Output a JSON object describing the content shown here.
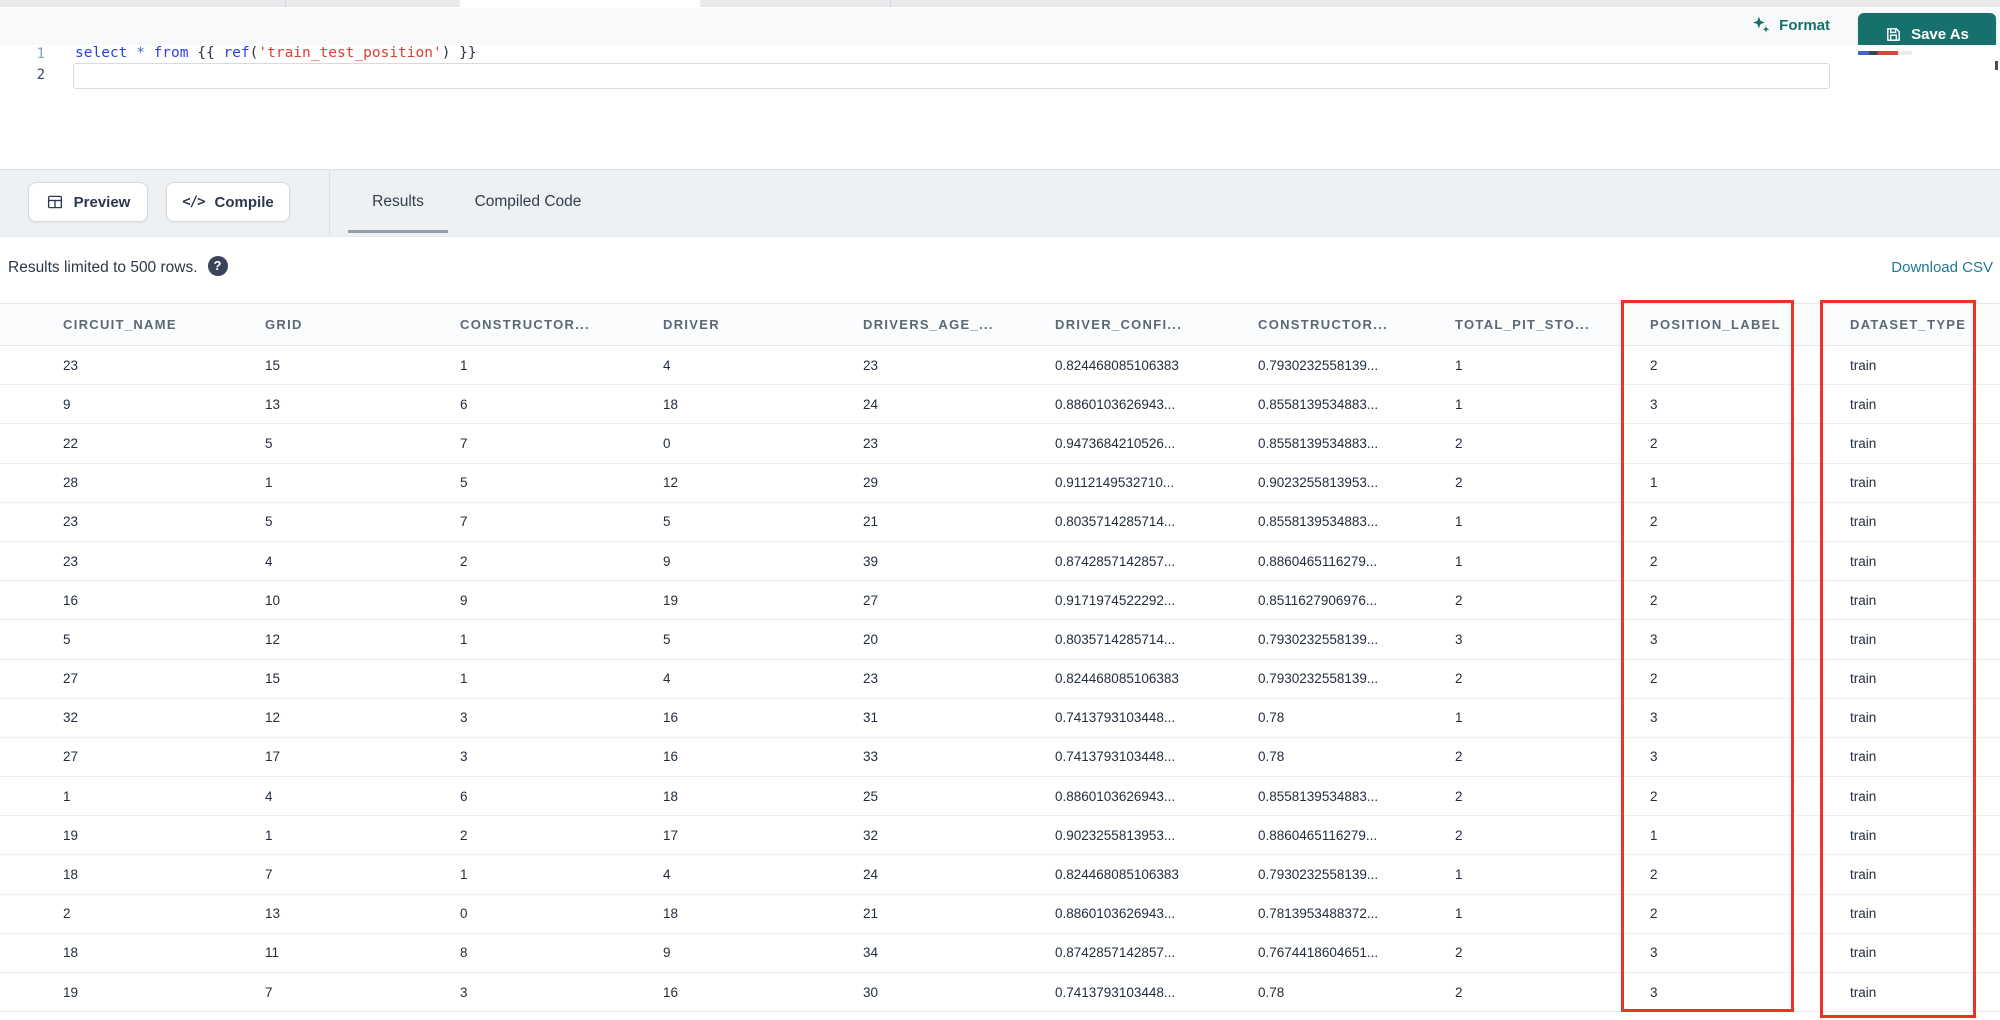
{
  "toolbar": {
    "format_label": "Format",
    "save_as_label": "Save As"
  },
  "editor": {
    "lines": [
      {
        "number": "1",
        "tokens": [
          {
            "t": "select ",
            "c": "kw"
          },
          {
            "t": "* ",
            "c": "op"
          },
          {
            "t": "from ",
            "c": "kw"
          },
          {
            "t": "{{ ",
            "c": "br"
          },
          {
            "t": "ref",
            "c": "fn"
          },
          {
            "t": "(",
            "c": "br"
          },
          {
            "t": "'train_test_position'",
            "c": "str"
          },
          {
            "t": ")",
            "c": "br"
          },
          {
            "t": " }}",
            "c": "br"
          }
        ]
      },
      {
        "number": "2",
        "tokens": []
      }
    ]
  },
  "actions": {
    "preview_label": "Preview",
    "compile_label": "Compile"
  },
  "tabs": [
    {
      "label": "Results",
      "active": true
    },
    {
      "label": "Compiled Code",
      "active": false
    }
  ],
  "results_bar": {
    "message": "Results limited to 500 rows.",
    "help_icon": "question-mark",
    "download_label": "Download CSV"
  },
  "table": {
    "columns": [
      "CIRCUIT_NAME",
      "GRID",
      "CONSTRUCTOR...",
      "DRIVER",
      "DRIVERS_AGE_...",
      "DRIVER_CONFI...",
      "CONSTRUCTOR...",
      "TOTAL_PIT_STO...",
      "POSITION_LABEL",
      "DATASET_TYPE"
    ],
    "rows": [
      [
        "23",
        "15",
        "1",
        "4",
        "23",
        "0.824468085106383",
        "0.7930232558139...",
        "1",
        "2",
        "train"
      ],
      [
        "9",
        "13",
        "6",
        "18",
        "24",
        "0.8860103626943...",
        "0.8558139534883...",
        "1",
        "3",
        "train"
      ],
      [
        "22",
        "5",
        "7",
        "0",
        "23",
        "0.9473684210526...",
        "0.8558139534883...",
        "2",
        "2",
        "train"
      ],
      [
        "28",
        "1",
        "5",
        "12",
        "29",
        "0.9112149532710...",
        "0.9023255813953...",
        "2",
        "1",
        "train"
      ],
      [
        "23",
        "5",
        "7",
        "5",
        "21",
        "0.8035714285714...",
        "0.8558139534883...",
        "1",
        "2",
        "train"
      ],
      [
        "23",
        "4",
        "2",
        "9",
        "39",
        "0.8742857142857...",
        "0.8860465116279...",
        "1",
        "2",
        "train"
      ],
      [
        "16",
        "10",
        "9",
        "19",
        "27",
        "0.9171974522292...",
        "0.8511627906976...",
        "2",
        "2",
        "train"
      ],
      [
        "5",
        "12",
        "1",
        "5",
        "20",
        "0.8035714285714...",
        "0.7930232558139...",
        "3",
        "3",
        "train"
      ],
      [
        "27",
        "15",
        "1",
        "4",
        "23",
        "0.824468085106383",
        "0.7930232558139...",
        "2",
        "2",
        "train"
      ],
      [
        "32",
        "12",
        "3",
        "16",
        "31",
        "0.7413793103448...",
        "0.78",
        "1",
        "3",
        "train"
      ],
      [
        "27",
        "17",
        "3",
        "16",
        "33",
        "0.7413793103448...",
        "0.78",
        "2",
        "3",
        "train"
      ],
      [
        "1",
        "4",
        "6",
        "18",
        "25",
        "0.8860103626943...",
        "0.8558139534883...",
        "2",
        "2",
        "train"
      ],
      [
        "19",
        "1",
        "2",
        "17",
        "32",
        "0.9023255813953...",
        "0.8860465116279...",
        "2",
        "1",
        "train"
      ],
      [
        "18",
        "7",
        "1",
        "4",
        "24",
        "0.824468085106383",
        "0.7930232558139...",
        "1",
        "2",
        "train"
      ],
      [
        "2",
        "13",
        "0",
        "18",
        "21",
        "0.8860103626943...",
        "0.7813953488372...",
        "1",
        "2",
        "train"
      ],
      [
        "18",
        "11",
        "8",
        "9",
        "34",
        "0.8742857142857...",
        "0.7674418604651...",
        "2",
        "3",
        "train"
      ],
      [
        "19",
        "7",
        "3",
        "16",
        "30",
        "0.7413793103448...",
        "0.78",
        "2",
        "3",
        "train"
      ]
    ]
  },
  "annotations": {
    "highlighted_columns": [
      "POSITION_LABEL",
      "DATASET_TYPE"
    ],
    "highlight_color": "#ec3323"
  },
  "colors": {
    "accent_teal": "#16706c",
    "link_teal": "#20798c",
    "keyword_blue": "#2d3fe0",
    "string_red": "#de3d36"
  }
}
